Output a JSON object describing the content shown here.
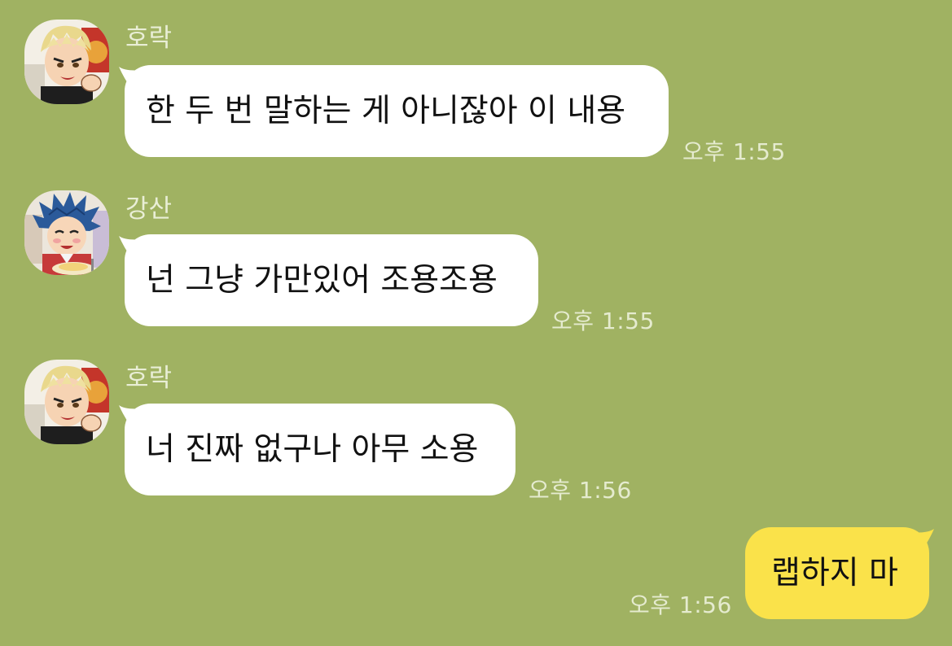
{
  "messages": [
    {
      "sender": "호락",
      "text": "한 두 번 말하는 게 아니잖아 이 내용",
      "time": "오후 1:55"
    },
    {
      "sender": "강산",
      "text": "넌 그냥 가만있어 조용조용",
      "time": "오후 1:55"
    },
    {
      "sender": "호락",
      "text": "너 진짜 없구나 아무 소용",
      "time": "오후 1:56"
    },
    {
      "sender": "",
      "text": "랩하지 마",
      "time": "오후 1:56",
      "mine": true
    }
  ],
  "colors": {
    "background": "#a0b262",
    "bubble_other": "#ffffff",
    "bubble_mine": "#fae24a"
  }
}
